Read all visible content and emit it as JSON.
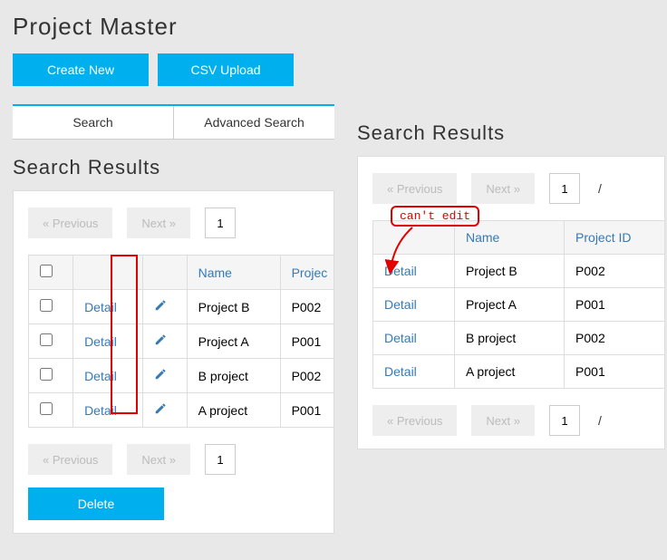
{
  "title": "Project Master",
  "buttons": {
    "create": "Create New",
    "csv": "CSV Upload",
    "delete": "Delete"
  },
  "tabs": {
    "search": "Search",
    "advanced": "Advanced Search"
  },
  "results_title": "Search Results",
  "pager": {
    "prev": "«  Previous",
    "next": "Next  »",
    "page": "1"
  },
  "columns": {
    "name": "Name",
    "project_id": "Project ID",
    "detail": "Detail"
  },
  "left_rows": [
    {
      "name": "Project B",
      "pid": "P002"
    },
    {
      "name": "Project A",
      "pid": "P001"
    },
    {
      "name": "B project",
      "pid": "P002"
    },
    {
      "name": "A project",
      "pid": "P001"
    }
  ],
  "right_rows": [
    {
      "name": "Project B",
      "pid": "P002"
    },
    {
      "name": "Project A",
      "pid": "P001"
    },
    {
      "name": "B project",
      "pid": "P002"
    },
    {
      "name": "A project",
      "pid": "P001"
    }
  ],
  "annotation": "can't edit"
}
